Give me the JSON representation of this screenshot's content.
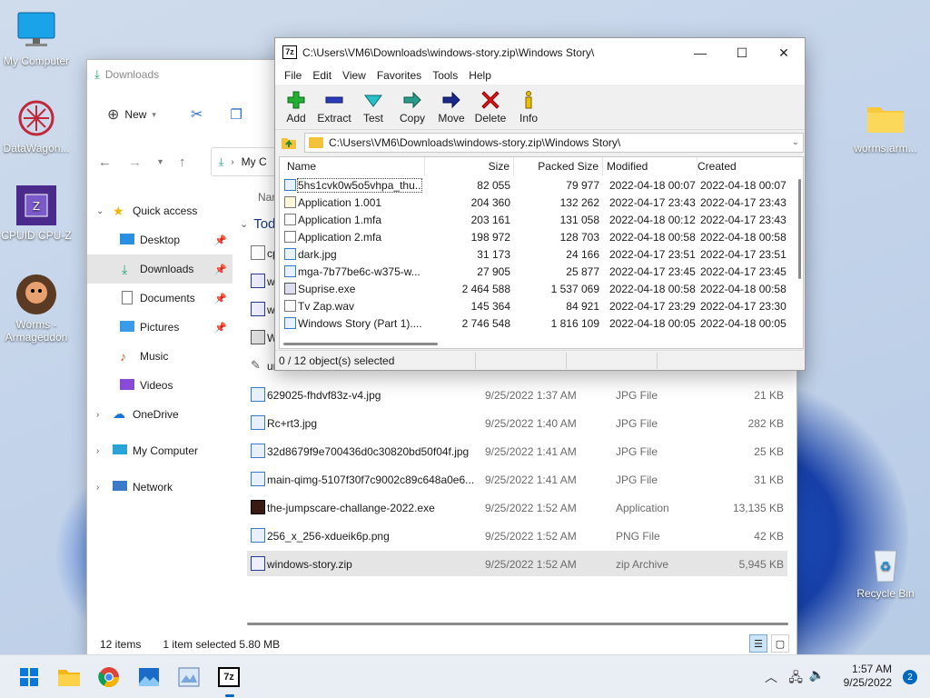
{
  "desktop": {
    "icons": [
      {
        "label": "My Computer"
      },
      {
        "label": "DataWagon..."
      },
      {
        "label": "CPUID CPU-Z"
      },
      {
        "label": "Worms - Armageddon"
      },
      {
        "label": "worms.arm..."
      },
      {
        "label": "Recycle Bin"
      }
    ]
  },
  "explorer": {
    "title": "Downloads",
    "cmdbar": {
      "new_label": "New"
    },
    "address_short": "My C",
    "column_name": "Nam",
    "group_label": "Toda",
    "sidebar": [
      {
        "label": "Quick access"
      },
      {
        "label": "Desktop"
      },
      {
        "label": "Downloads"
      },
      {
        "label": "Documents"
      },
      {
        "label": "Pictures"
      },
      {
        "label": "Music"
      },
      {
        "label": "Videos"
      },
      {
        "label": "OneDrive"
      },
      {
        "label": "My Computer"
      },
      {
        "label": "Network"
      }
    ],
    "partial_rows": [
      {
        "name": "cp"
      },
      {
        "name": "w"
      },
      {
        "name": "w"
      },
      {
        "name": "W"
      },
      {
        "name": "ur"
      }
    ],
    "files": [
      {
        "name": "629025-fhdvf83z-v4.jpg",
        "date": "9/25/2022 1:37 AM",
        "type": "JPG File",
        "size": "21 KB"
      },
      {
        "name": "Rc+rt3.jpg",
        "date": "9/25/2022 1:40 AM",
        "type": "JPG File",
        "size": "282 KB"
      },
      {
        "name": "32d8679f9e700436d0c30820bd50f04f.jpg",
        "date": "9/25/2022 1:41 AM",
        "type": "JPG File",
        "size": "25 KB"
      },
      {
        "name": "main-qimg-5107f30f7c9002c89c648a0e6...",
        "date": "9/25/2022 1:41 AM",
        "type": "JPG File",
        "size": "31 KB"
      },
      {
        "name": "the-jumpscare-challange-2022.exe",
        "date": "9/25/2022 1:52 AM",
        "type": "Application",
        "size": "13,135 KB"
      },
      {
        "name": "256_x_256-xdueik6p.png",
        "date": "9/25/2022 1:52 AM",
        "type": "PNG File",
        "size": "42 KB"
      },
      {
        "name": "windows-story.zip",
        "date": "9/25/2022 1:52 AM",
        "type": "zip Archive",
        "size": "5,945 KB"
      }
    ],
    "status": {
      "items": "12 items",
      "selected": "1 item selected  5.80 MB"
    }
  },
  "zip": {
    "title": "C:\\Users\\VM6\\Downloads\\windows-story.zip\\Windows Story\\",
    "menu": [
      "File",
      "Edit",
      "View",
      "Favorites",
      "Tools",
      "Help"
    ],
    "toolbar": [
      "Add",
      "Extract",
      "Test",
      "Copy",
      "Move",
      "Delete",
      "Info"
    ],
    "address": "C:\\Users\\VM6\\Downloads\\windows-story.zip\\Windows Story\\",
    "columns": [
      "Name",
      "Size",
      "Packed Size",
      "Modified",
      "Created"
    ],
    "rows": [
      {
        "name": "5hs1cvk0w5o5vhpa_thu...",
        "size": "82 055",
        "packed": "79 977",
        "modified": "2022-04-18 00:07",
        "created": "2022-04-18 00:07"
      },
      {
        "name": "Application 1.001",
        "size": "204 360",
        "packed": "132 262",
        "modified": "2022-04-17 23:43",
        "created": "2022-04-17 23:43"
      },
      {
        "name": "Application 1.mfa",
        "size": "203 161",
        "packed": "131 058",
        "modified": "2022-04-18 00:12",
        "created": "2022-04-17 23:43"
      },
      {
        "name": "Application 2.mfa",
        "size": "198 972",
        "packed": "128 703",
        "modified": "2022-04-18 00:58",
        "created": "2022-04-18 00:58"
      },
      {
        "name": "dark.jpg",
        "size": "31 173",
        "packed": "24 166",
        "modified": "2022-04-17 23:51",
        "created": "2022-04-17 23:51"
      },
      {
        "name": "mga-7b77be6c-w375-w...",
        "size": "27 905",
        "packed": "25 877",
        "modified": "2022-04-17 23:45",
        "created": "2022-04-17 23:45"
      },
      {
        "name": "Suprise.exe",
        "size": "2 464 588",
        "packed": "1 537 069",
        "modified": "2022-04-18 00:58",
        "created": "2022-04-18 00:58"
      },
      {
        "name": "Tv Zap.wav",
        "size": "145 364",
        "packed": "84 921",
        "modified": "2022-04-17 23:29",
        "created": "2022-04-17 23:30"
      },
      {
        "name": "Windows Story (Part 1)....",
        "size": "2 746 548",
        "packed": "1 816 109",
        "modified": "2022-04-18 00:05",
        "created": "2022-04-18 00:05"
      }
    ],
    "status": "0 / 12 object(s) selected"
  },
  "taskbar": {
    "time": "1:57 AM",
    "date": "9/25/2022",
    "notifications": "2"
  }
}
